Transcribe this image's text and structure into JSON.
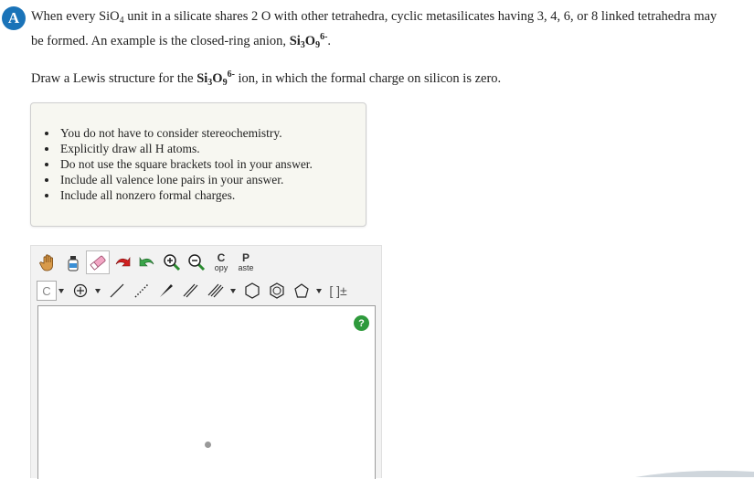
{
  "question": {
    "badge": "A",
    "line1_a": "When every SiO",
    "line1_sub": "4",
    "line1_b": " unit in a silicate shares 2 O with other tetrahedra, cyclic metasilicates having 3, 4, 6, or 8 linked tetrahedra may",
    "line2_a": "be formed. An example is the closed-ring anion, ",
    "ion_si": "Si",
    "ion_si_sub": "3",
    "ion_o": "O",
    "ion_o_sub": "9",
    "ion_charge": "6-",
    "line2_end": ".",
    "line3_a": "Draw a Lewis structure for the ",
    "line3_b": " ion, in which the formal charge on silicon is zero."
  },
  "hints": [
    "You do not have to consider stereochemistry.",
    "Explicitly draw all H atoms.",
    "Do not use the square brackets tool in your answer.",
    "Include all valence lone pairs in your answer.",
    "Include all nonzero formal charges."
  ],
  "toolbar": {
    "copy_big": "C",
    "copy_small": "opy",
    "paste_big": "P",
    "paste_small": "aste",
    "atom_label": "C",
    "help_label": "?"
  },
  "colors": {
    "badge": "#1a73b8",
    "help": "#2e9a3c",
    "hint_bg": "#f7f7f1"
  }
}
